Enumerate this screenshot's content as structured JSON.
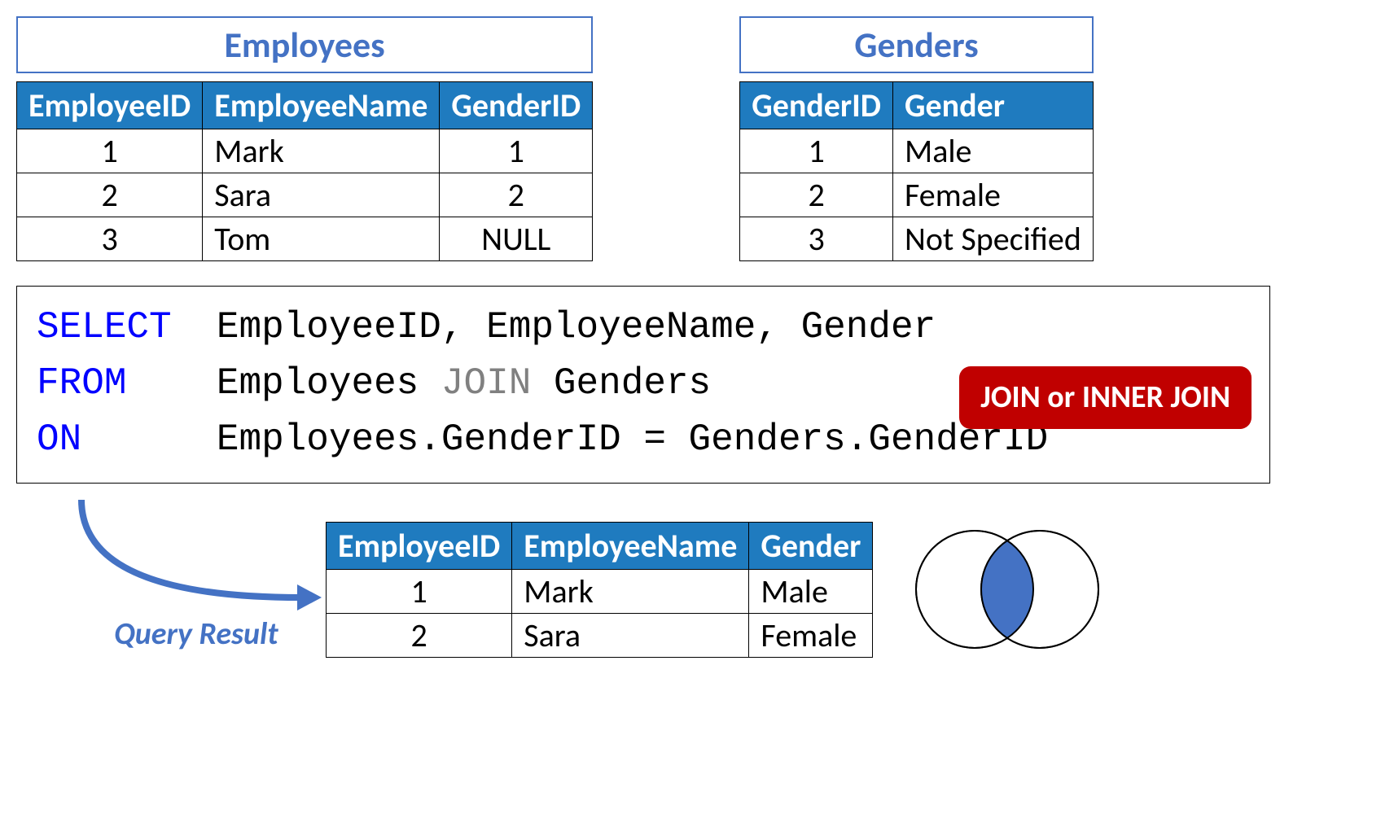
{
  "employees": {
    "title": "Employees",
    "headers": [
      "EmployeeID",
      "EmployeeName",
      "GenderID"
    ],
    "rows": [
      [
        "1",
        "Mark",
        "1"
      ],
      [
        "2",
        "Sara",
        "2"
      ],
      [
        "3",
        "Tom",
        "NULL"
      ]
    ]
  },
  "genders": {
    "title": "Genders",
    "headers": [
      "GenderID",
      "Gender"
    ],
    "rows": [
      [
        "1",
        "Male"
      ],
      [
        "2",
        "Female"
      ],
      [
        "3",
        "Not Specified"
      ]
    ]
  },
  "sql": {
    "select": "SELECT",
    "select_cols": "EmployeeID, EmployeeName, Gender",
    "from": "FROM",
    "from_t1": "Employees ",
    "join_kw": "JOIN",
    "from_t2": " Genders",
    "on": "ON",
    "on_cond": "Employees.GenderID = Genders.GenderID",
    "badge": "JOIN or INNER JOIN"
  },
  "result": {
    "label": "Query Result",
    "headers": [
      "EmployeeID",
      "EmployeeName",
      "Gender"
    ],
    "rows": [
      [
        "1",
        "Mark",
        "Male"
      ],
      [
        "2",
        "Sara",
        "Female"
      ]
    ]
  }
}
